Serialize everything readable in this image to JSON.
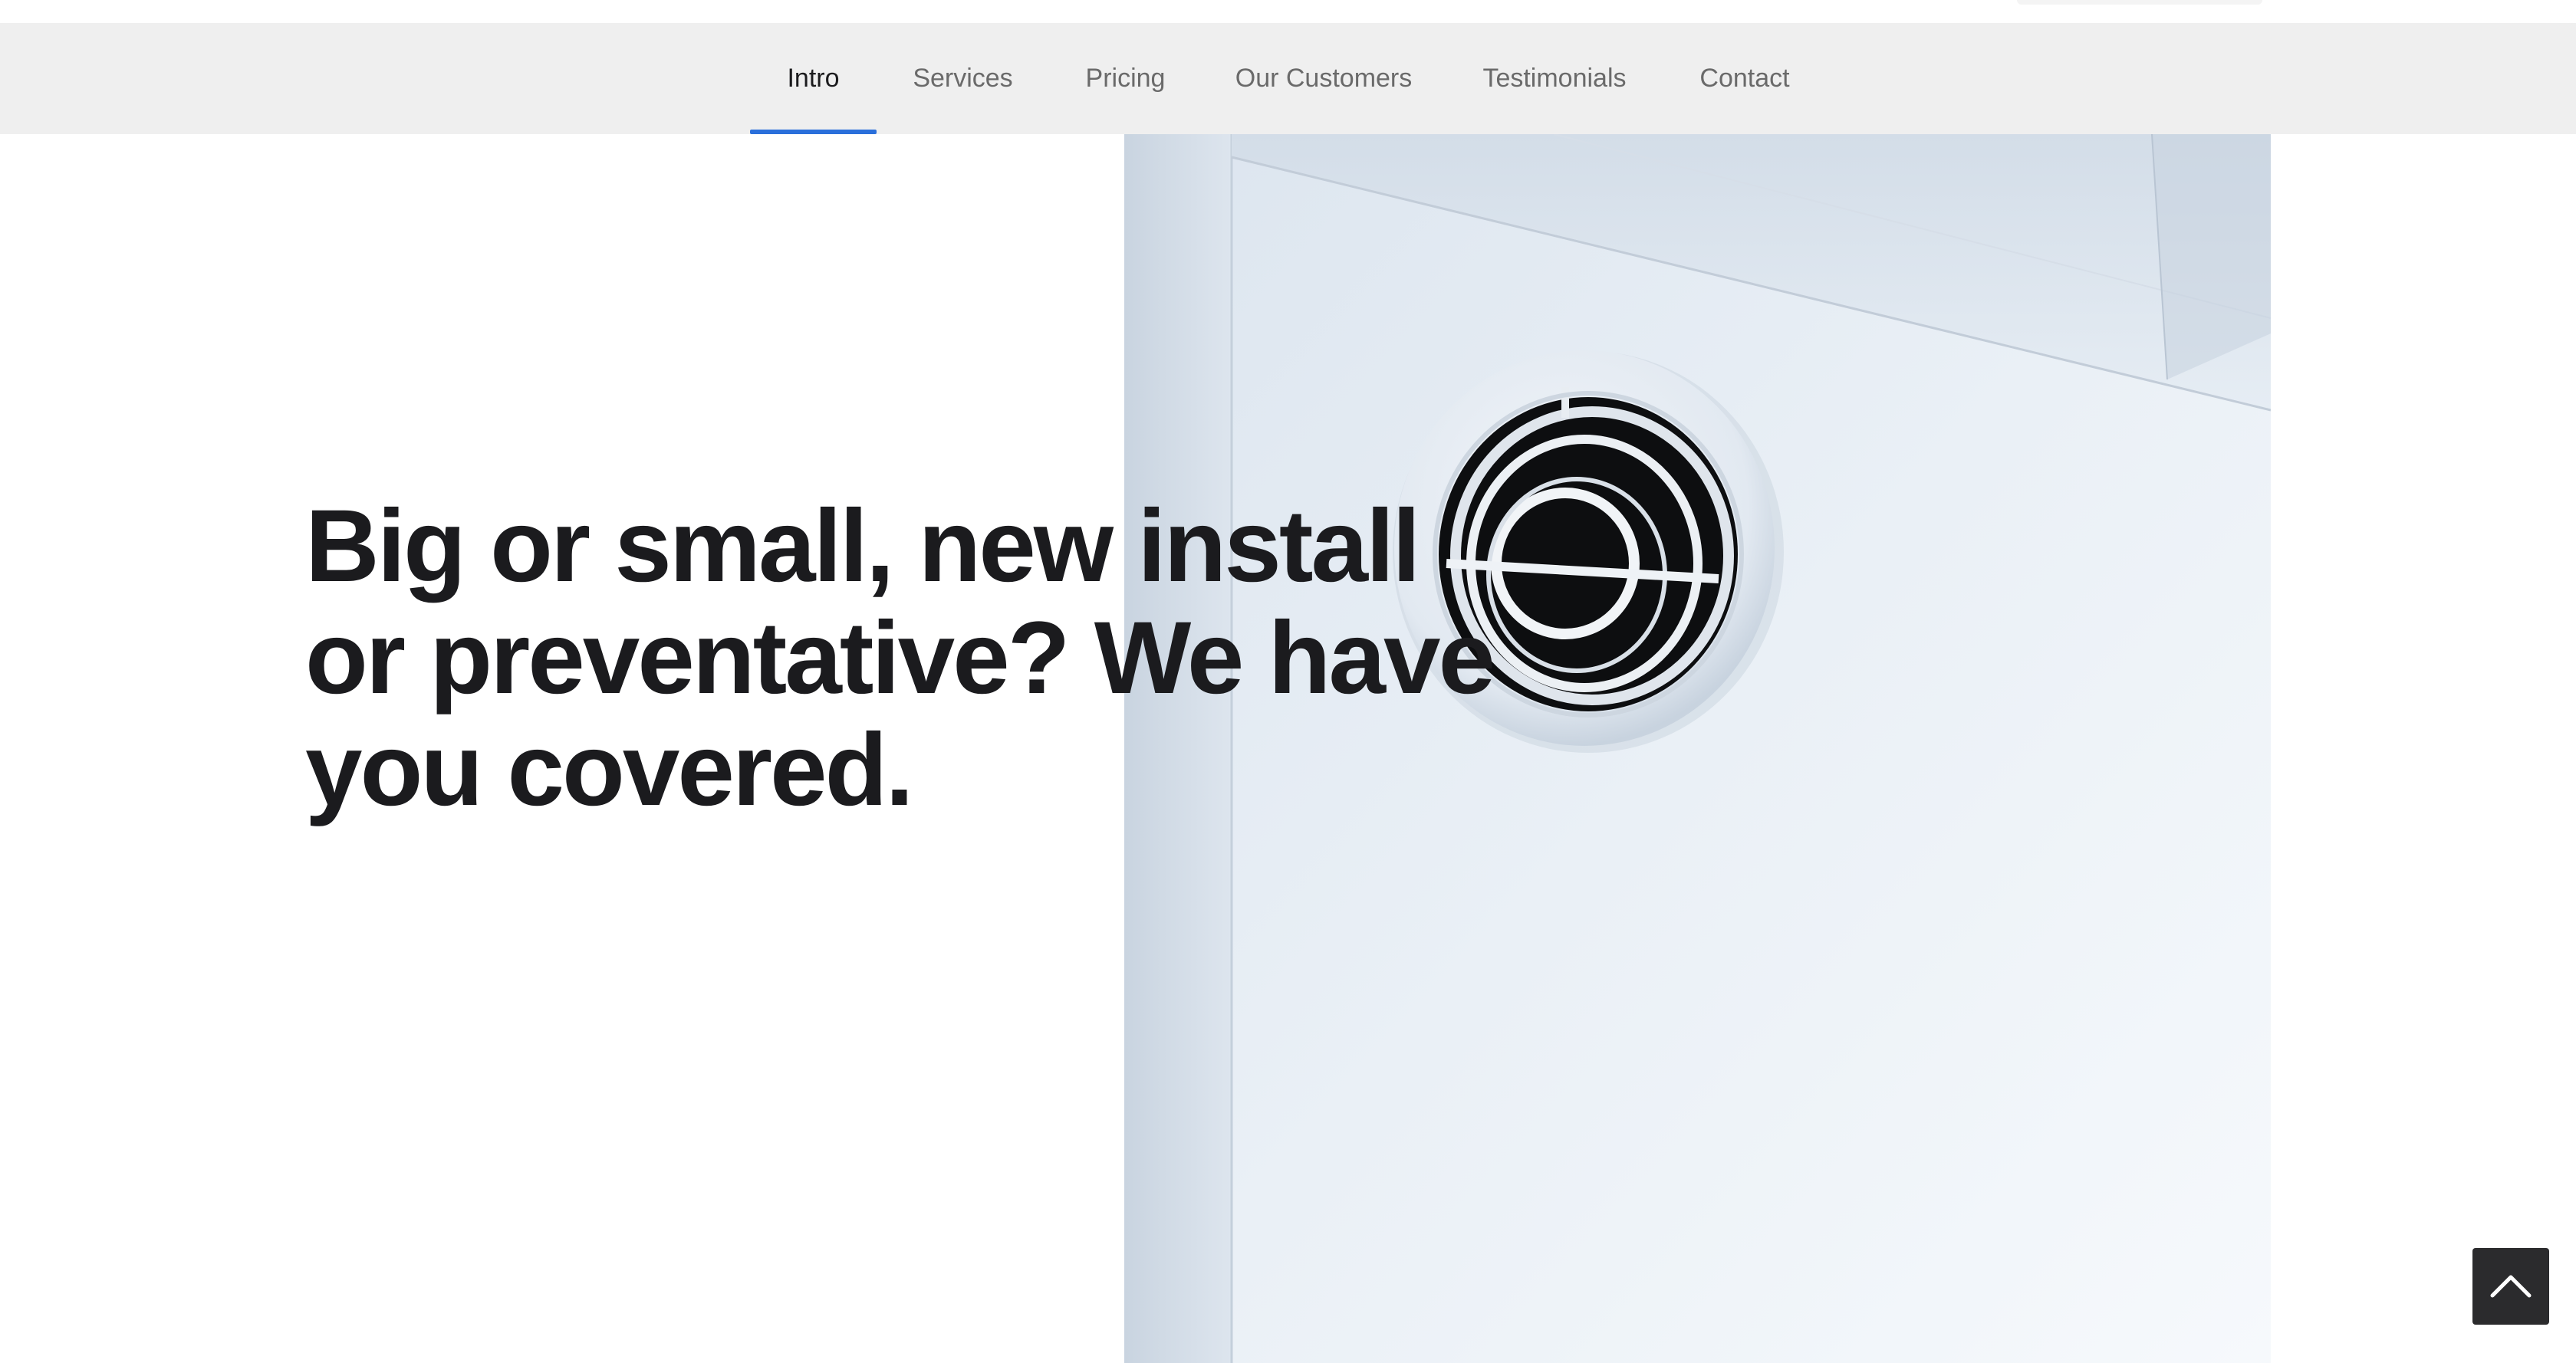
{
  "nav": {
    "items": [
      {
        "label": "Intro",
        "active": true
      },
      {
        "label": "Services",
        "active": false
      },
      {
        "label": "Pricing",
        "active": false
      },
      {
        "label": "Our Customers",
        "active": false
      },
      {
        "label": "Testimonials",
        "active": false
      },
      {
        "label": "Contact",
        "active": false
      }
    ],
    "accent_color": "#2a6fdb"
  },
  "hero": {
    "headline": "Big or small, new install or preventative? We have you covered.",
    "image_subject": "air-vent-photo"
  },
  "scroll_top": {
    "icon": "chevron-up-icon"
  }
}
